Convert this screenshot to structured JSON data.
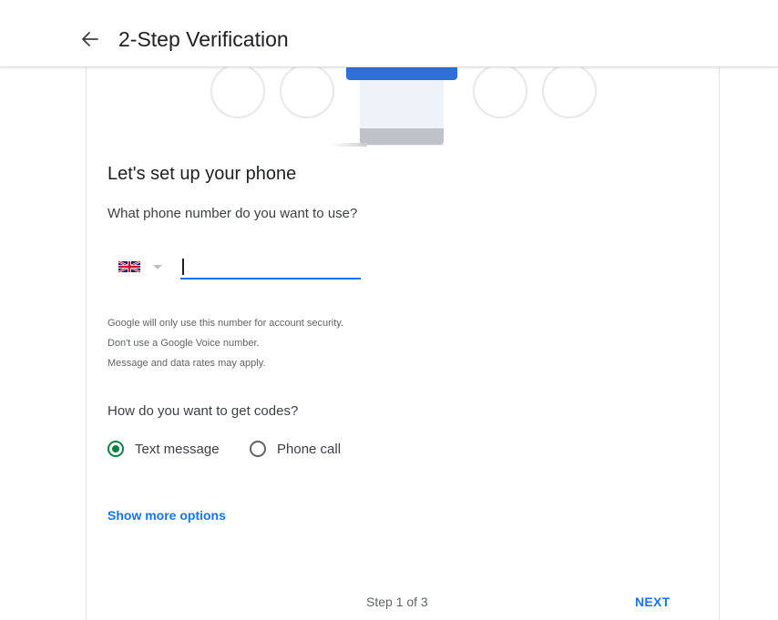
{
  "header": {
    "title": "2-Step Verification",
    "back_icon": "arrow-back-icon"
  },
  "hero": {
    "illustration": "phone-code-illustration"
  },
  "setup": {
    "heading": "Let's set up your phone",
    "question": "What phone number do you want to use?"
  },
  "phone": {
    "country_flag": "uk-flag-icon",
    "value": "",
    "placeholder": ""
  },
  "info": {
    "line1": "Google will only use this number for account security.",
    "line2": "Don't use a Google Voice number.",
    "line3": "Message and data rates may apply."
  },
  "codes": {
    "question": "How do you want to get codes?",
    "options": [
      {
        "label": "Text message",
        "selected": true
      },
      {
        "label": "Phone call",
        "selected": false
      }
    ]
  },
  "more_options_label": "Show more options",
  "footer": {
    "step": "Step 1 of 3",
    "next_label": "NEXT"
  },
  "colors": {
    "accent": "#1a73e8",
    "radio_selected": "#0b8043",
    "text": "#202124",
    "secondary_text": "#5f6368"
  }
}
